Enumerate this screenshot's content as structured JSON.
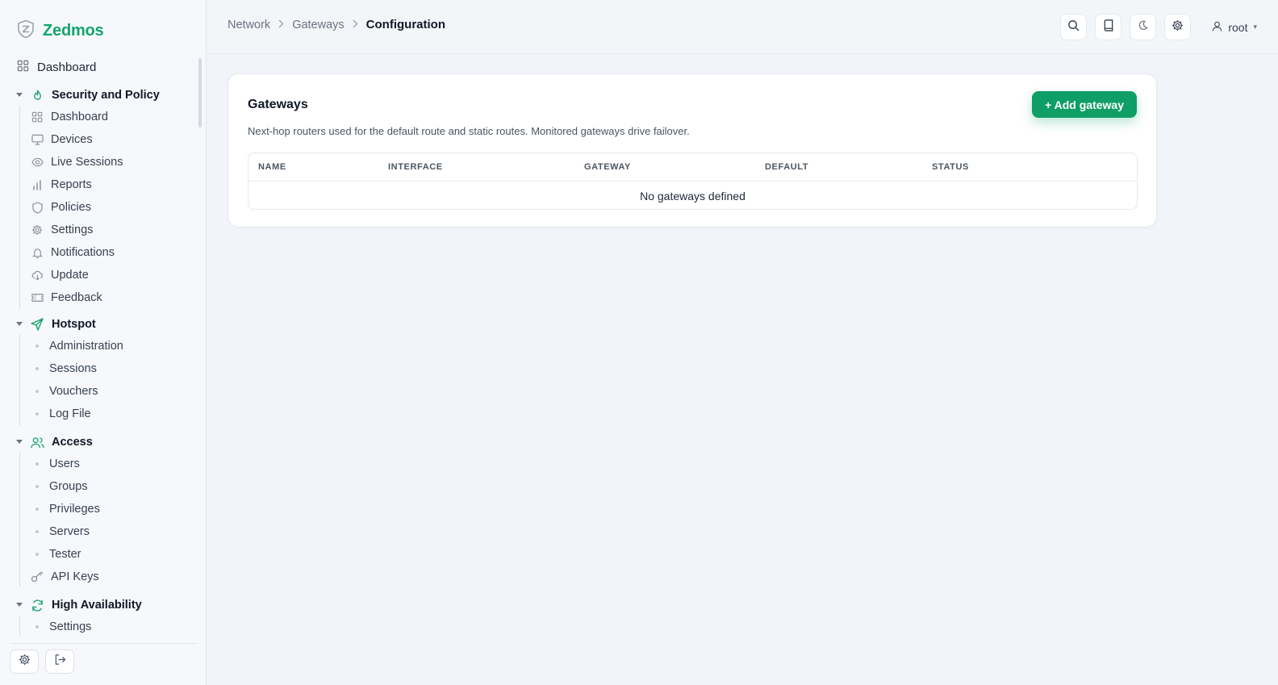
{
  "brand": {
    "name": "Zedmos",
    "accent": "#15a36b"
  },
  "sidebar": {
    "top_item": {
      "label": "Dashboard",
      "icon": "dashboard-grid-icon"
    },
    "groups": [
      {
        "label": "Security and Policy",
        "icon": "flame-icon",
        "items": [
          {
            "label": "Dashboard",
            "icon": "dashboard-grid-icon"
          },
          {
            "label": "Devices",
            "icon": "monitor-icon"
          },
          {
            "label": "Live Sessions",
            "icon": "eye-icon"
          },
          {
            "label": "Reports",
            "icon": "bar-chart-icon"
          },
          {
            "label": "Policies",
            "icon": "shield-icon"
          },
          {
            "label": "Settings",
            "icon": "gear-icon"
          },
          {
            "label": "Notifications",
            "icon": "bell-icon"
          },
          {
            "label": "Update",
            "icon": "cloud-download-icon"
          },
          {
            "label": "Feedback",
            "icon": "ticket-icon"
          }
        ]
      },
      {
        "label": "Hotspot",
        "icon": "send-icon",
        "items": [
          {
            "label": "Administration"
          },
          {
            "label": "Sessions"
          },
          {
            "label": "Vouchers"
          },
          {
            "label": "Log File"
          }
        ]
      },
      {
        "label": "Access",
        "icon": "users-icon",
        "items": [
          {
            "label": "Users"
          },
          {
            "label": "Groups"
          },
          {
            "label": "Privileges"
          },
          {
            "label": "Servers"
          },
          {
            "label": "Tester"
          },
          {
            "label": "API Keys",
            "icon": "key-icon"
          }
        ]
      },
      {
        "label": "High Availability",
        "icon": "refresh-icon",
        "items": [
          {
            "label": "Settings"
          }
        ]
      }
    ]
  },
  "header": {
    "breadcrumb": [
      "Network",
      "Gateways",
      "Configuration"
    ],
    "user": "root"
  },
  "card": {
    "title": "Gateways",
    "description": "Next-hop routers used for the default route and static routes. Monitored gateways drive failover.",
    "add_button": "+ Add gateway",
    "columns": [
      "NAME",
      "INTERFACE",
      "GATEWAY",
      "DEFAULT",
      "STATUS"
    ],
    "empty_text": "No gateways defined"
  }
}
